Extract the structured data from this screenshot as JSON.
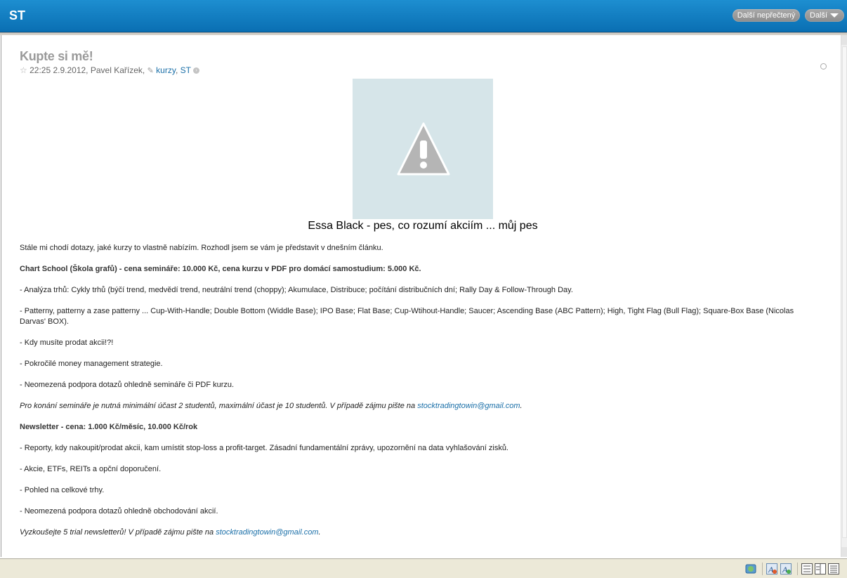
{
  "topbar": {
    "title": "ST",
    "unread_label": "Další nepřečtený",
    "more_label": "Další"
  },
  "post": {
    "title": "Kupte si mě!",
    "time": "22:25 2.9.2012,",
    "author": "Pavel Kařízek,",
    "tags": [
      "kurzy",
      "ST"
    ],
    "tag_sep": ",",
    "image_caption": "Essa Black - pes, co rozumí akciím ... můj pes",
    "intro": "Stále mi chodí dotazy, jaké kurzy to vlastně nabízím. Rozhodl jsem se vám je představit v dnešním článku.",
    "chart_school_heading": "Chart School (Škola grafů) - cena semináře: 10.000 Kč, cena kurzu v PDF pro domácí samostudium: 5.000 Kč.",
    "chart_school_items": [
      "- Analýza trhů: Cykly trhů (býčí trend, medvědí trend, neutrální trend (choppy); Akumulace, Distribuce; počítání distribučních dní; Rally Day & Follow-Through Day.",
      "- Patterny, patterny a zase patterny ... Cup-With-Handle; Double Bottom (Widdle Base); IPO Base; Flat Base; Cup-Wtihout-Handle; Saucer; Ascending Base (ABC Pattern); High, Tight Flag (Bull Flag); Square-Box Base (Nicolas Darvas' BOX).",
      "- Kdy musíte prodat akcii!?!",
      "- Pokročilé money management strategie.",
      "- Neomezená podpora dotazů ohledně semináře či PDF kurzu."
    ],
    "chart_school_note": "Pro konání semináře je nutná minimální účast 2 studentů, maximální účast je 10 studentů. V případě zájmu pište na",
    "chart_school_email": "stocktradingtowin@gmail.com",
    "chart_school_note_end": ".",
    "newsletter_heading": "Newsletter - cena: 1.000 Kč/měsíc, 10.000 Kč/rok",
    "newsletter_items": [
      "- Reporty, kdy nakoupit/prodat akcii, kam umístit stop-loss a profit-target. Zásadní fundamentální zprávy, upozornění na data vyhlašování zisků.",
      "- Akcie, ETFs, REITs a opční doporučení.",
      "- Pohled na celkové trhy.",
      "- Neomezená podpora dotazů ohledně obchodování akcií."
    ],
    "newsletter_note": "Vyzkoušejte 5 trial newsletterů! V případě zájmu pište na",
    "newsletter_email": "stocktradingtowin@gmail.com",
    "newsletter_note_end": "."
  },
  "colors": {
    "topbar": "#0a6fb3",
    "link": "#1a6fa8",
    "image_placeholder": "#d6e5e9"
  },
  "icons": [
    "star-icon",
    "paperclip-icon",
    "arrow-circle-icon",
    "warning-icon",
    "sync-icon",
    "font-icon",
    "layout-icon"
  ]
}
